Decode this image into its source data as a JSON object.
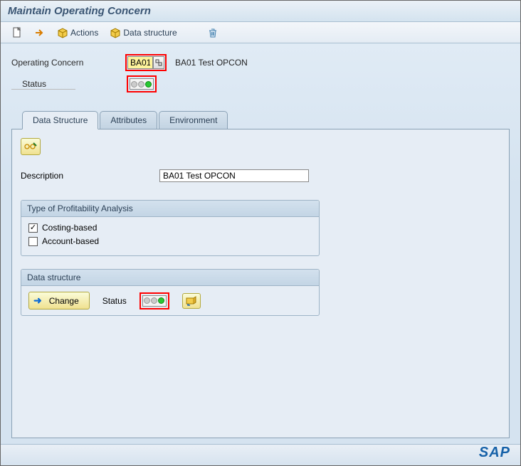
{
  "title": "Maintain Operating Concern",
  "toolbar": {
    "actions_label": "Actions",
    "data_structure_label": "Data structure"
  },
  "operating_concern": {
    "label": "Operating Concern",
    "value": "BA01",
    "description": "BA01 Test OPCON",
    "status_label": "Status"
  },
  "tabs": {
    "data_structure": "Data Structure",
    "attributes": "Attributes",
    "environment": "Environment"
  },
  "panel": {
    "description_label": "Description",
    "description_value": "BA01 Test OPCON",
    "tpa_title": "Type of Profitability Analysis",
    "costing_based": {
      "label": "Costing-based",
      "checked": true
    },
    "account_based": {
      "label": "Account-based",
      "checked": false
    },
    "ds_title": "Data structure",
    "change_label": "Change",
    "ds_status_label": "Status"
  }
}
